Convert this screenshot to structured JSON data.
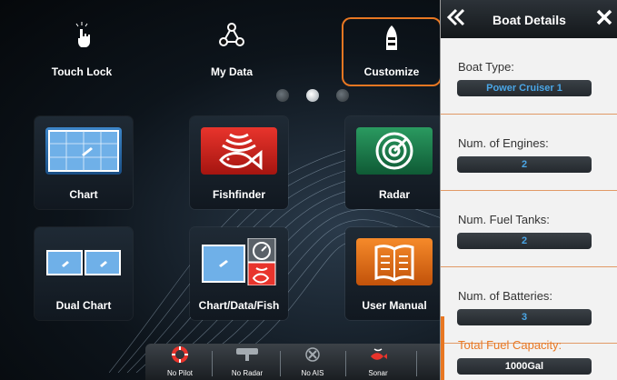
{
  "top_bar": {
    "touch_lock": "Touch Lock",
    "my_data": "My Data",
    "customize": "Customize"
  },
  "page_dots": {
    "count": 3,
    "active_index": 1
  },
  "tiles": {
    "chart": "Chart",
    "fishfinder": "Fishfinder",
    "radar": "Radar",
    "dual_chart": "Dual Chart",
    "chart_data_fish": "Chart/Data/Fish",
    "user_manual": "User Manual"
  },
  "bottom_bar": {
    "pilot": "No Pilot",
    "radar": "No Radar",
    "ais": "No AIS",
    "sonar": "Sonar"
  },
  "panel": {
    "title": "Boat Details",
    "fields": {
      "boat_type": {
        "label": "Boat Type:",
        "value": "Power Cruiser 1"
      },
      "engines": {
        "label": "Num. of Engines:",
        "value": "2"
      },
      "tanks": {
        "label": "Num. Fuel Tanks:",
        "value": "2"
      },
      "batteries": {
        "label": "Num. of Batteries:",
        "value": "3"
      },
      "capacity": {
        "label": "Total Fuel Capacity:",
        "value": "1000Gal"
      }
    }
  },
  "colors": {
    "accent": "#e87722",
    "value_text": "#4aa6e6",
    "panel_bg": "#f2f2f2"
  }
}
